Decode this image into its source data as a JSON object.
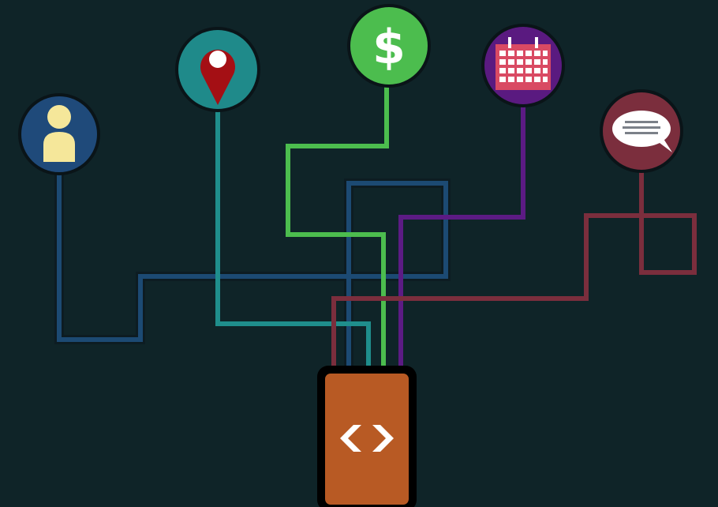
{
  "diagram": {
    "hub": {
      "icon": "code-brackets-icon",
      "color": "#b85a24",
      "border_color": "#000000"
    },
    "nodes": [
      {
        "id": "user",
        "icon": "user-icon",
        "color": "#1f4a7a",
        "accent": "#f5e79a"
      },
      {
        "id": "location",
        "icon": "location-pin-icon",
        "color": "#1f8a8a",
        "accent": "#a40f14"
      },
      {
        "id": "payment",
        "icon": "dollar-icon",
        "color": "#4cbd4e",
        "accent": "#ffffff",
        "glyph": "$"
      },
      {
        "id": "calendar",
        "icon": "calendar-icon",
        "color": "#5a1a80",
        "accent": "#d94a63"
      },
      {
        "id": "chat",
        "icon": "chat-bubble-icon",
        "color": "#7b2e3d",
        "accent": "#ffffff"
      }
    ],
    "background": "#0f2428"
  }
}
